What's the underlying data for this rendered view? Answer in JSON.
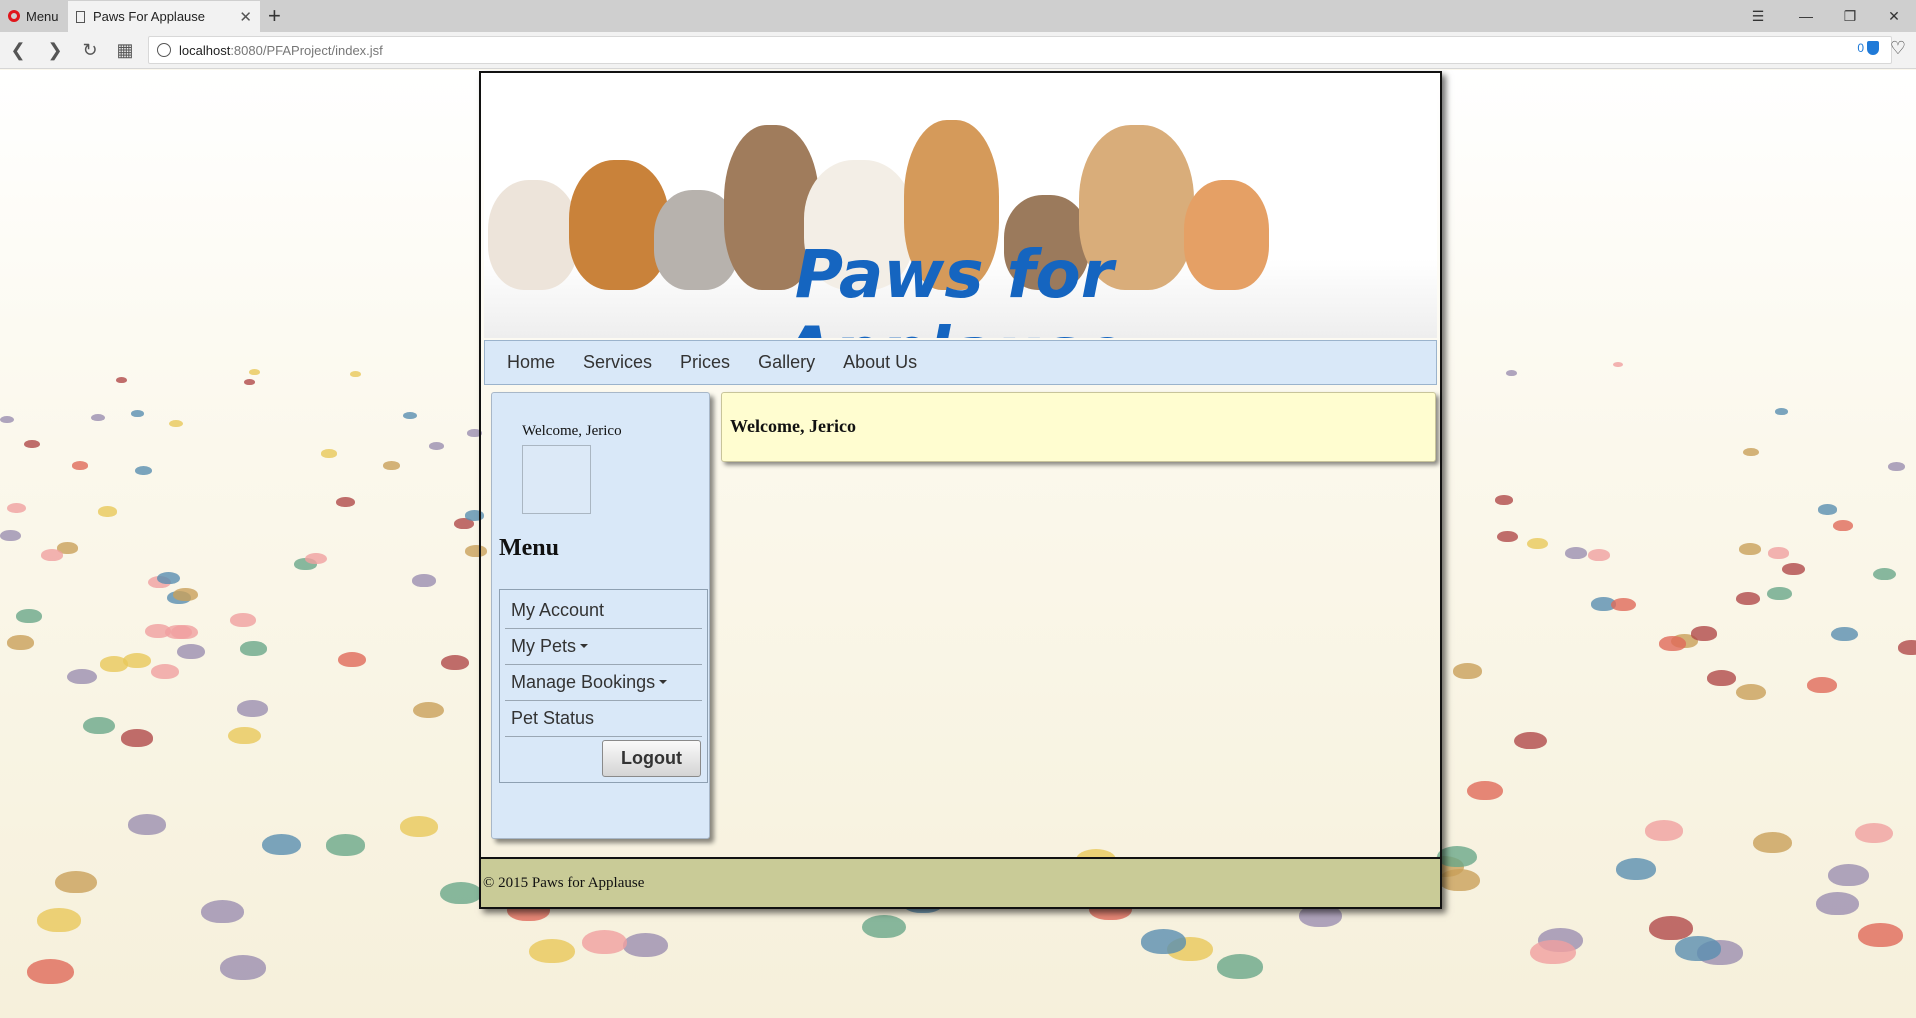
{
  "browser": {
    "menu_label": "Menu",
    "tab_title": "Paws For Applause",
    "url_host": "localhost",
    "url_path": ":8080/PFAProject/index.jsf",
    "blocked_count": "0"
  },
  "site": {
    "title": "Paws for Applause",
    "nav": [
      "Home",
      "Services",
      "Prices",
      "Gallery",
      "About Us"
    ],
    "sidebar": {
      "welcome": "Welcome, Jerico",
      "menu_title": "Menu",
      "items": [
        {
          "label": "My Account",
          "dropdown": false
        },
        {
          "label": "My Pets",
          "dropdown": true
        },
        {
          "label": "Manage Bookings",
          "dropdown": true
        },
        {
          "label": "Pet Status",
          "dropdown": false
        }
      ],
      "logout_label": "Logout"
    },
    "content": {
      "heading": "Welcome, Jerico"
    },
    "footer": "© 2015 Paws for Applause"
  },
  "colors": {
    "brand_title": "#1565c0",
    "nav_bg": "#d9e8f8",
    "content_bg": "#fffdd0",
    "footer_bg": "#c9cb97"
  }
}
